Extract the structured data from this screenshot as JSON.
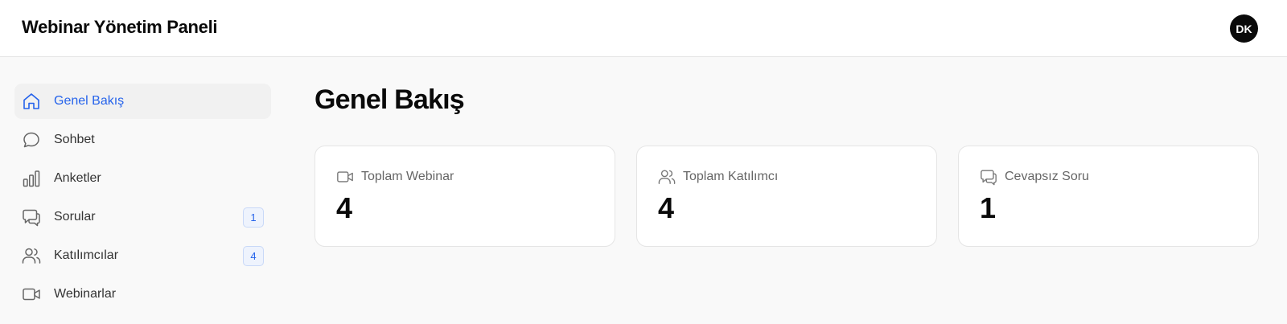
{
  "header": {
    "title": "Webinar Yönetim Paneli",
    "avatar_initials": "DK"
  },
  "sidebar": {
    "items": [
      {
        "label": "Genel Bakış",
        "icon": "home-icon",
        "active": true
      },
      {
        "label": "Sohbet",
        "icon": "chat-bubble-icon"
      },
      {
        "label": "Anketler",
        "icon": "bar-chart-icon"
      },
      {
        "label": "Sorular",
        "icon": "messages-icon",
        "badge": "1"
      },
      {
        "label": "Katılımcılar",
        "icon": "users-icon",
        "badge": "4"
      },
      {
        "label": "Webinarlar",
        "icon": "video-icon"
      }
    ]
  },
  "main": {
    "title": "Genel Bakış",
    "stats": [
      {
        "label": "Toplam Webinar",
        "value": "4",
        "icon": "video-icon"
      },
      {
        "label": "Toplam Katılımcı",
        "value": "4",
        "icon": "users-icon"
      },
      {
        "label": "Cevapsız Soru",
        "value": "1",
        "icon": "messages-icon"
      }
    ]
  },
  "colors": {
    "accent": "#2563eb",
    "background": "#f9f9f9",
    "surface": "#ffffff",
    "border": "#e5e5e5"
  }
}
